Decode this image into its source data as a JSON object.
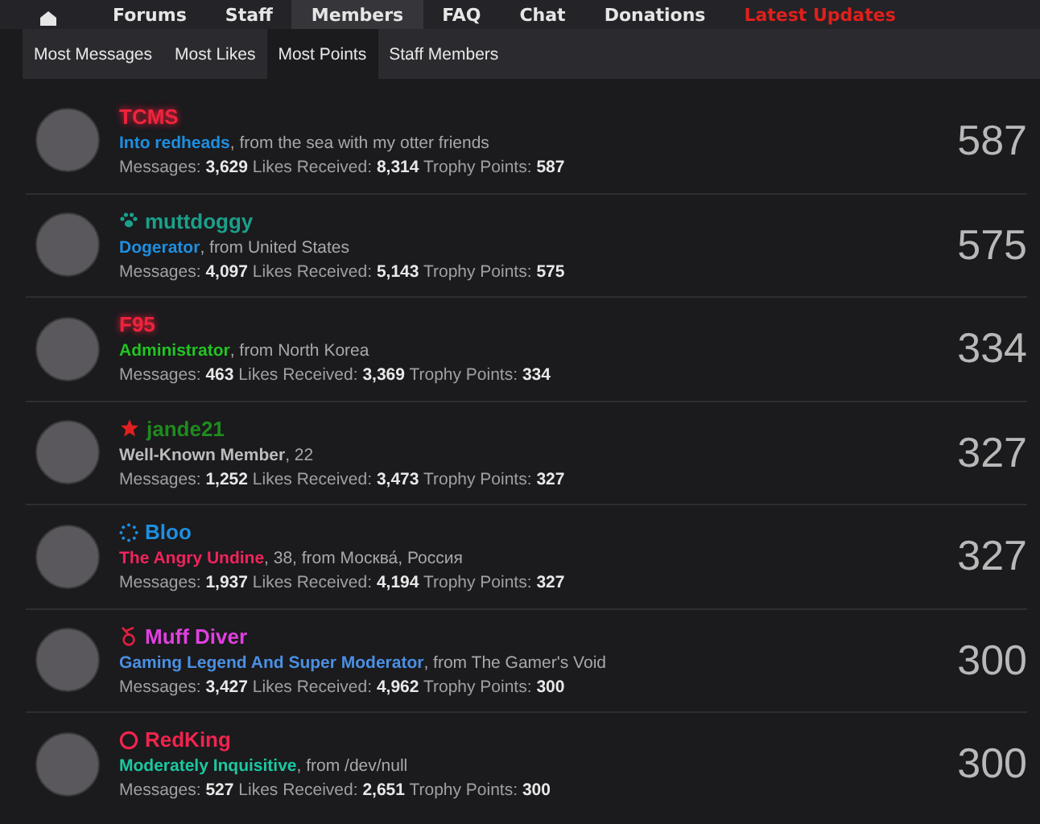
{
  "nav": [
    {
      "label": "Forums",
      "selected": false,
      "color": "#e6e6e6"
    },
    {
      "label": "Staff",
      "selected": false,
      "color": "#e6e6e6"
    },
    {
      "label": "Members",
      "selected": true,
      "color": "#e6e6e6"
    },
    {
      "label": "FAQ",
      "selected": false,
      "color": "#e6e6e6"
    },
    {
      "label": "Chat",
      "selected": false,
      "color": "#e6e6e6"
    },
    {
      "label": "Donations",
      "selected": false,
      "color": "#e6e6e6"
    },
    {
      "label": "Latest Updates",
      "selected": false,
      "color": "#e0201c"
    }
  ],
  "tabs": [
    {
      "label": "Most Messages",
      "selected": false
    },
    {
      "label": "Most Likes",
      "selected": false
    },
    {
      "label": "Most Points",
      "selected": true
    },
    {
      "label": "Staff Members",
      "selected": false
    }
  ],
  "members": [
    {
      "name": "TCMS",
      "color": "#f0243c",
      "glow": true,
      "kind": "none",
      "title": {
        "text": "Into redheads",
        "color": "#1e8fe0"
      },
      "detail": ", from the sea with my otter friends",
      "stats": "Messages: **3,629** Likes Received: **8,314** Trophy Points: **587**",
      "points": "587"
    },
    {
      "name": "muttdoggy",
      "color": "#1ba08a",
      "glow": false,
      "kind": "paw",
      "title": {
        "text": "Dogerator",
        "color": "#1e8fe0"
      },
      "detail": ", from United States",
      "stats": "Messages: **4,097** Likes Received: **5,143** Trophy Points: **575**",
      "points": "575"
    },
    {
      "name": "F95",
      "color": "#f0243c",
      "glow": true,
      "kind": "none",
      "title": {
        "text": "Administrator",
        "color": "#22c322"
      },
      "detail": ", from North Korea",
      "stats": "Messages: **463** Likes Received: **3,369** Trophy Points: **334**",
      "points": "334"
    },
    {
      "name": "jande21",
      "color": "#1f8a1f",
      "glow": false,
      "kind": "star",
      "title": {
        "text": "Well-Known Member",
        "color": "#bdbdbd"
      },
      "detail": ", 22",
      "stats": "Messages: **1,252** Likes Received: **3,473** Trophy Points: **327**",
      "points": "327"
    },
    {
      "name": "Bloo",
      "color": "#1e8fe0",
      "glow": false,
      "kind": "dots",
      "title": {
        "text": "The Angry Undine",
        "color": "#f0245c"
      },
      "detail": ", 38, from Москва́, Россия",
      "stats": "Messages: **1,937** Likes Received: **4,194** Trophy Points: **327**",
      "points": "327"
    },
    {
      "name": "Muff Diver",
      "color": "#e040e0",
      "glow": false,
      "kind": "knot",
      "title": {
        "text": "Gaming Legend And Super Moderator",
        "color": "#4a90e2"
      },
      "detail": ", from The Gamer's Void",
      "stats": "Messages: **3,427** Likes Received: **4,962** Trophy Points: **300**",
      "points": "300"
    },
    {
      "name": "RedKing",
      "color": "#f0244c",
      "glow": false,
      "kind": "ring",
      "title": {
        "text": "Moderately Inquisitive",
        "color": "#1ac8a0"
      },
      "detail": ", from /dev/null",
      "stats": "Messages: **527** Likes Received: **2,651** Trophy Points: **300**",
      "points": "300"
    }
  ]
}
